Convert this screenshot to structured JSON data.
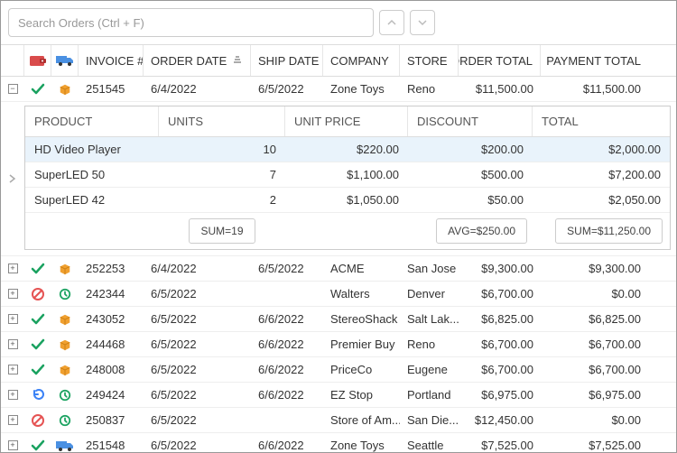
{
  "search": {
    "placeholder": "Search Orders (Ctrl + F)"
  },
  "columns": {
    "invoice": "INVOICE #",
    "order_date": "ORDER DATE",
    "ship_date": "SHIP DATE",
    "company": "COMPANY",
    "store": "STORE",
    "order_total": "ORDER TOTAL",
    "payment_total": "PAYMENT TOTAL"
  },
  "detail_columns": {
    "product": "PRODUCT",
    "units": "UNITS",
    "unit_price": "UNIT PRICE",
    "discount": "DISCOUNT",
    "total": "TOTAL"
  },
  "rows": [
    {
      "invoice": "251545",
      "order_date": "6/4/2022",
      "ship_date": "6/5/2022",
      "company": "Zone Toys",
      "store": "Reno",
      "order_total": "$11,500.00",
      "payment_total": "$11,500.00",
      "status": "check",
      "shipping": "box",
      "expanded": true
    },
    {
      "invoice": "252253",
      "order_date": "6/4/2022",
      "ship_date": "6/5/2022",
      "company": "ACME",
      "store": "San Jose",
      "order_total": "$9,300.00",
      "payment_total": "$9,300.00",
      "status": "check",
      "shipping": "box"
    },
    {
      "invoice": "242344",
      "order_date": "6/5/2022",
      "ship_date": "",
      "company": "Walters",
      "store": "Denver",
      "order_total": "$6,700.00",
      "payment_total": "$0.00",
      "status": "deny",
      "shipping": "clock"
    },
    {
      "invoice": "243052",
      "order_date": "6/5/2022",
      "ship_date": "6/6/2022",
      "company": "StereoShack",
      "store": "Salt Lak...",
      "order_total": "$6,825.00",
      "payment_total": "$6,825.00",
      "status": "check",
      "shipping": "box"
    },
    {
      "invoice": "244468",
      "order_date": "6/5/2022",
      "ship_date": "6/6/2022",
      "company": "Premier Buy",
      "store": "Reno",
      "order_total": "$6,700.00",
      "payment_total": "$6,700.00",
      "status": "check",
      "shipping": "box"
    },
    {
      "invoice": "248008",
      "order_date": "6/5/2022",
      "ship_date": "6/6/2022",
      "company": "PriceCo",
      "store": "Eugene",
      "order_total": "$6,700.00",
      "payment_total": "$6,700.00",
      "status": "check",
      "shipping": "box"
    },
    {
      "invoice": "249424",
      "order_date": "6/5/2022",
      "ship_date": "6/6/2022",
      "company": "EZ Stop",
      "store": "Portland",
      "order_total": "$6,975.00",
      "payment_total": "$6,975.00",
      "status": "return",
      "shipping": "clock"
    },
    {
      "invoice": "250837",
      "order_date": "6/5/2022",
      "ship_date": "",
      "company": "Store of Am...",
      "store": "San Die...",
      "order_total": "$12,450.00",
      "payment_total": "$0.00",
      "status": "deny",
      "shipping": "clock"
    },
    {
      "invoice": "251548",
      "order_date": "6/5/2022",
      "ship_date": "6/6/2022",
      "company": "Zone Toys",
      "store": "Seattle",
      "order_total": "$7,525.00",
      "payment_total": "$7,525.00",
      "status": "check",
      "shipping": "truck"
    }
  ],
  "detail_rows": [
    {
      "product": "HD Video Player",
      "units": "10",
      "unit_price": "$220.00",
      "discount": "$200.00",
      "total": "$2,000.00",
      "selected": true
    },
    {
      "product": "SuperLED 50",
      "units": "7",
      "unit_price": "$1,100.00",
      "discount": "$500.00",
      "total": "$7,200.00"
    },
    {
      "product": "SuperLED 42",
      "units": "2",
      "unit_price": "$1,050.00",
      "discount": "$50.00",
      "total": "$2,050.00"
    }
  ],
  "summary": {
    "units_sum": "SUM=19",
    "discount_avg": "AVG=$250.00",
    "total_sum": "SUM=$11,250.00"
  },
  "icons": {
    "wallet_color": "#d94b4b",
    "truck_color": "#4a90e2",
    "check_color": "#1aa260",
    "deny_color": "#e55353",
    "return_color": "#3b82f6",
    "clock_color": "#1aa260",
    "box_color": "#f0a030"
  }
}
